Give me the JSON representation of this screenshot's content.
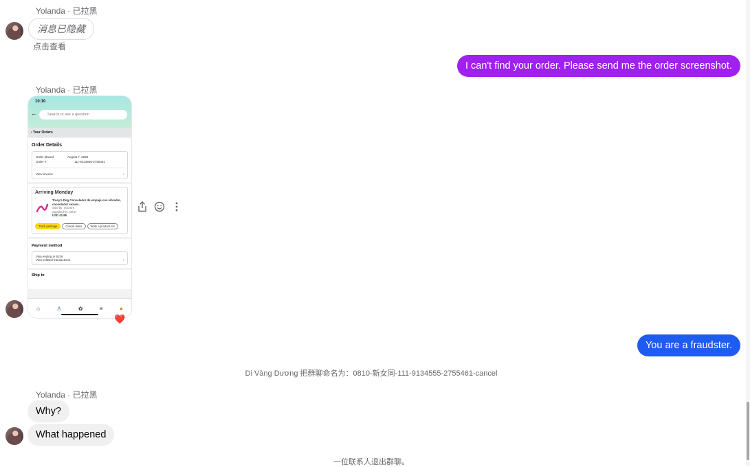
{
  "messages": {
    "sender_top": "Yolanda · 已拉黑",
    "hidden_text": "消息已隐藏",
    "hidden_note": "点击查看",
    "out_1": "I can't find your order. Please send me the order screenshot.",
    "sender_mid": "Yolanda · 已拉黑",
    "out_2": "You are a fraudster.",
    "system_rename": "Di Vàng Dương 把群聊命名为：0810-新女同-111-9134555-2755461-cancel",
    "sender_bottom": "Yolanda · 已拉黑",
    "in_1": "Why?",
    "in_2": "What happened",
    "system_left": "一位联系人退出群聊。"
  },
  "reaction": "❤️",
  "colors": {
    "out_1_bg": "#a020f0",
    "out_2_bg": "#1e5bf0"
  },
  "screenshot": {
    "time": "10:10",
    "search_placeholder": "Search or ask a question",
    "crumb": "‹ Your Orders",
    "order_details_title": "Order Details",
    "order_placed_label": "Order placed",
    "order_placed_value": "August 7, 2025",
    "order_num_label": "Order #",
    "order_num_value": "111-9134555-2755461",
    "view_invoice": "View invoice",
    "arriving": "Arriving Monday",
    "product_title": "Tracy's Dog Consolador de empuje con vibrador, consolador sexual...",
    "sold_by": "Sold by: eclixsire",
    "supplied_by": "Supplied by: Other",
    "price": "USD 42.85",
    "btn_track": "Track package",
    "btn_cancel": "Cancel items",
    "btn_review": "Write a product rev",
    "payment_title": "Payment method",
    "visa": "Visa ending in 6226",
    "view_transactions": "View related transactions",
    "ship_to": "Ship to"
  },
  "icons": [
    "share-icon",
    "emoji-icon",
    "more-icon",
    "heart-reaction-icon"
  ]
}
